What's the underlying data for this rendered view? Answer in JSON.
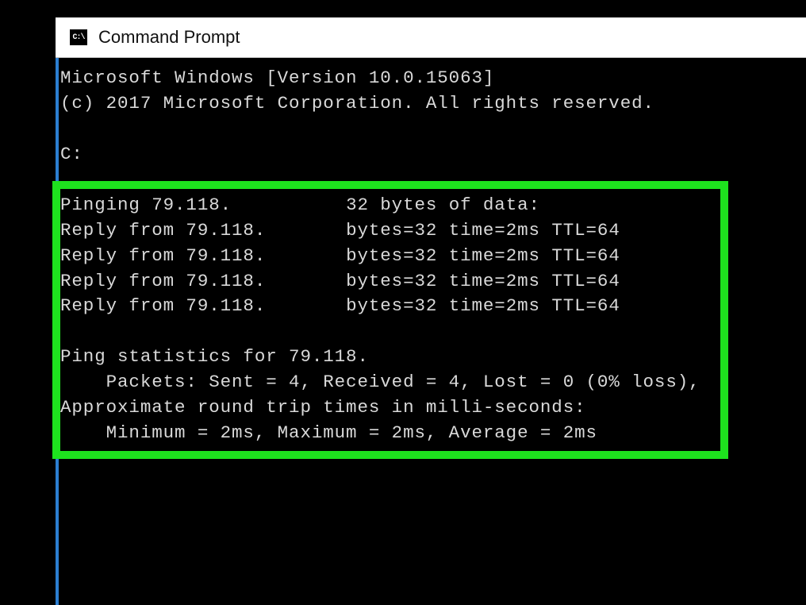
{
  "window": {
    "title": "Command Prompt",
    "icon_label": "C:\\"
  },
  "console": {
    "version_line": "Microsoft Windows [Version 10.0.15063]",
    "copyright_line": "(c) 2017 Microsoft Corporation. All rights reserved.",
    "prompt_line": "C:",
    "ping_header_left": "Pinging 79.118.",
    "ping_header_right": "32 bytes of data:",
    "reply_left": "Reply from 79.118.",
    "reply_right": "bytes=32 time=2ms TTL=64",
    "stats_header": "Ping statistics for 79.118.",
    "packets_line": "    Packets: Sent = 4, Received = 4, Lost = 0 (0% loss),",
    "rtt_header": "Approximate round trip times in milli-seconds:",
    "rtt_line": "    Minimum = 2ms, Maximum = 2ms, Average = 2ms"
  }
}
